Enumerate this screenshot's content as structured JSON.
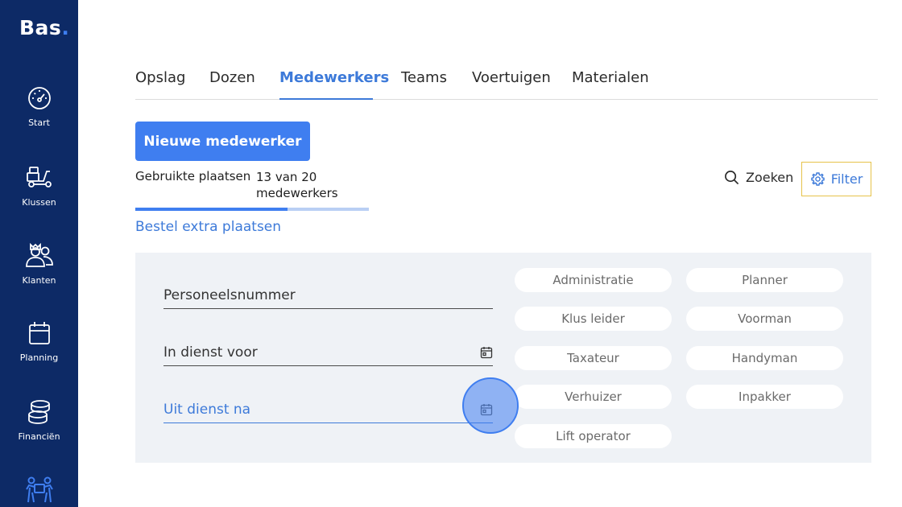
{
  "sidebar": {
    "logo_text": "Bas",
    "logo_dot": ".",
    "items": [
      {
        "label": "Start",
        "icon": "speedometer-icon"
      },
      {
        "label": "Klussen",
        "icon": "moving-truck-icon"
      },
      {
        "label": "Klanten",
        "icon": "customers-icon"
      },
      {
        "label": "Planning",
        "icon": "calendar-icon"
      },
      {
        "label": "Financiën",
        "icon": "coins-icon"
      },
      {
        "label": "",
        "icon": "staff-icon"
      }
    ]
  },
  "tabs": [
    {
      "label": "Opslag"
    },
    {
      "label": "Dozen"
    },
    {
      "label": "Medewerkers",
      "active": true
    },
    {
      "label": "Teams"
    },
    {
      "label": "Voertuigen"
    },
    {
      "label": "Materialen"
    }
  ],
  "main": {
    "new_button": "Nieuwe medewerker",
    "seats_label": "Gebruikte plaatsen",
    "seats_value": "13 van 20 medewerkers",
    "seats_progress": 0.65,
    "order_link": "Bestel extra plaatsen",
    "search_label": "Zoeken",
    "filter_label": "Filter"
  },
  "filters": {
    "fields": [
      {
        "label": "Personeelsnummer"
      },
      {
        "label": "In dienst voor"
      },
      {
        "label": "Uit dienst na"
      }
    ],
    "roles": [
      "Administratie",
      "Planner",
      "Klus leider",
      "Voorman",
      "Taxateur",
      "Handyman",
      "Verhuizer",
      "Inpakker",
      "Lift operator"
    ]
  },
  "colors": {
    "sidebar": "#0d2a66",
    "accent": "#3f7ef0",
    "link": "#3d7ad9",
    "filter_border": "#e6c34a",
    "panel": "#eff2f6"
  }
}
